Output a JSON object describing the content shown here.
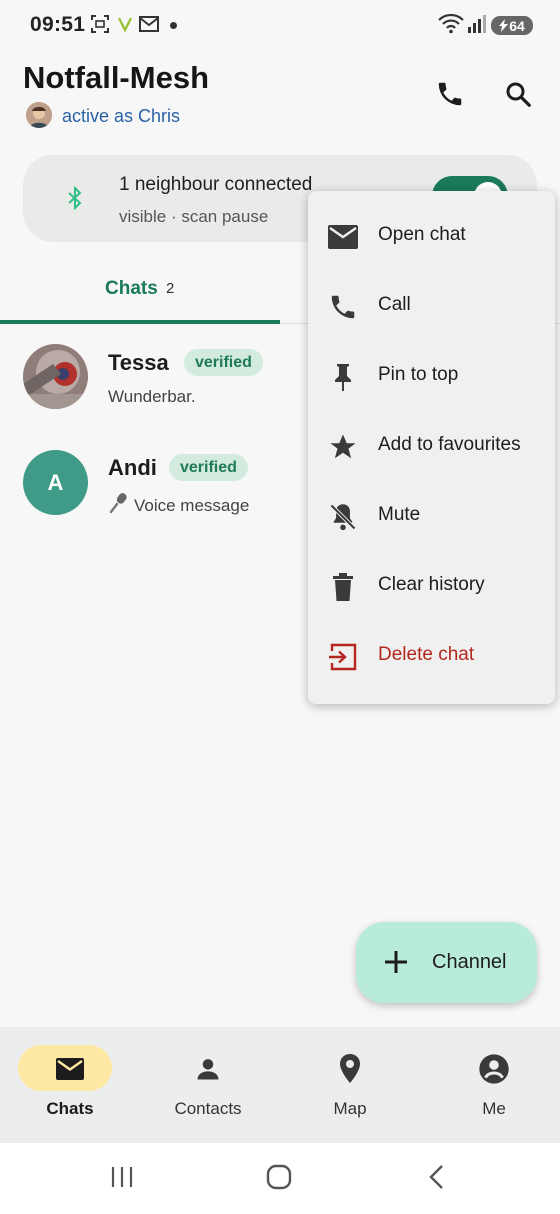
{
  "status_bar": {
    "time": "09:51",
    "battery": "64"
  },
  "header": {
    "title": "Notfall-Mesh",
    "active_as": "active as Chris"
  },
  "mesh": {
    "status": "1 neighbour connected",
    "substatus": "visible · scan pause",
    "enabled": true
  },
  "tabs": [
    {
      "label": "Chats",
      "count": "2"
    }
  ],
  "chats": [
    {
      "name": "Tessa",
      "badge": "verified",
      "preview": "Wunderbar."
    },
    {
      "name": "Andi",
      "badge": "verified",
      "preview": "Voice message",
      "initial": "A"
    }
  ],
  "menu": {
    "items": [
      {
        "label": "Open chat",
        "icon": "mail-icon"
      },
      {
        "label": "Call",
        "icon": "phone-icon"
      },
      {
        "label": "Pin to top",
        "icon": "pin-icon"
      },
      {
        "label": "Add to favourites",
        "icon": "star-icon"
      },
      {
        "label": "Mute",
        "icon": "bell-off-icon"
      },
      {
        "label": "Clear history",
        "icon": "trash-icon"
      },
      {
        "label": "Delete chat",
        "icon": "exit-icon"
      }
    ]
  },
  "fab": {
    "label": "Channel"
  },
  "bottom_nav": [
    {
      "label": "Chats",
      "icon": "mail-icon",
      "active": true
    },
    {
      "label": "Contacts",
      "icon": "person-icon"
    },
    {
      "label": "Map",
      "icon": "map-pin-icon"
    },
    {
      "label": "Me",
      "icon": "account-circle-icon"
    }
  ],
  "colors": {
    "accent": "#1a7a5a",
    "danger": "#b3271f",
    "fab": "#b8ecd9",
    "nav_active": "#fde8a4"
  }
}
